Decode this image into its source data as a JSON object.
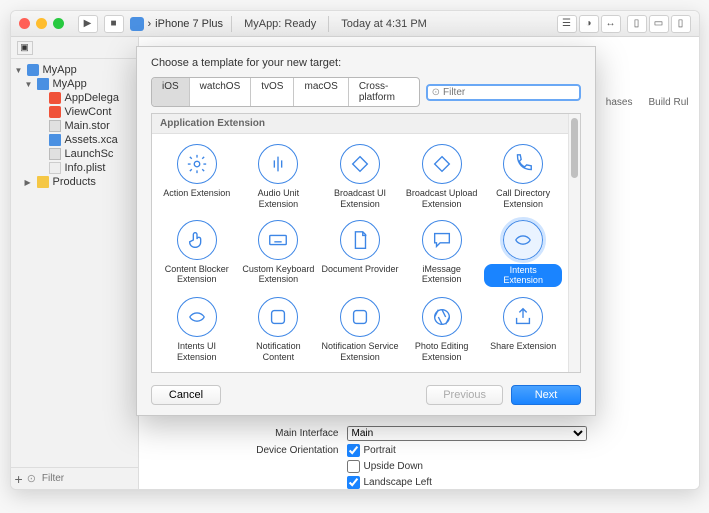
{
  "titlebar": {
    "device": "iPhone 7 Plus",
    "status": "MyApp: Ready",
    "time": "Today at 4:31 PM"
  },
  "sidebar": {
    "project": "MyApp",
    "group": "MyApp",
    "files": {
      "appdelegate": "AppDelega",
      "viewcontroller": "ViewCont",
      "mainstory": "Main.stor",
      "assets": "Assets.xca",
      "launch": "LaunchSc",
      "plist": "Info.plist"
    },
    "products": "Products",
    "filter_placeholder": "Filter"
  },
  "right_tabs": {
    "phases": "hases",
    "buildrules": "Build Rul"
  },
  "form": {
    "main_interface_label": "Main Interface",
    "main_interface_value": "Main",
    "orientation_label": "Device Orientation",
    "portrait": "Portrait",
    "upside_down": "Upside Down",
    "landscape_left": "Landscape Left"
  },
  "sheet": {
    "title": "Choose a template for your new target:",
    "tabs": {
      "ios": "iOS",
      "watchos": "watchOS",
      "tvos": "tvOS",
      "macos": "macOS",
      "cross": "Cross-platform"
    },
    "filter_placeholder": "Filter",
    "section": "Application Extension",
    "templates": {
      "action": "Action Extension",
      "audio": "Audio Unit Extension",
      "broadcast_ui": "Broadcast UI Extension",
      "broadcast_upload": "Broadcast Upload Extension",
      "calldir": "Call Directory Extension",
      "contentblocker": "Content Blocker Extension",
      "keyboard": "Custom Keyboard Extension",
      "docprovider": "Document Provider",
      "imessage": "iMessage Extension",
      "intents": "Intents Extension",
      "intentsui": "Intents UI Extension",
      "notifcontent": "Notification Content",
      "notifservice": "Notification Service Extension",
      "photoediting": "Photo Editing Extension",
      "share": "Share Extension"
    },
    "footer": {
      "cancel": "Cancel",
      "previous": "Previous",
      "next": "Next"
    }
  }
}
